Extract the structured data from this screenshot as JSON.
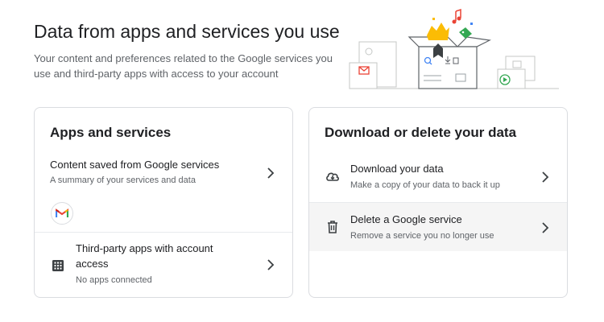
{
  "header": {
    "title": "Data from apps and services you use",
    "subtitle": "Your content and preferences related to the Google services you use and third-party apps with access to your account"
  },
  "apps_card": {
    "title": "Apps and services",
    "items": [
      {
        "title": "Content saved from Google services",
        "description": "A summary of your services and data",
        "icon": "gmail-icon"
      },
      {
        "title": "Third-party apps with account access",
        "description": "No apps connected",
        "icon": "apps-grid-icon"
      }
    ]
  },
  "data_card": {
    "title": "Download or delete your data",
    "items": [
      {
        "title": "Download your data",
        "description": "Make a copy of your data to back it up",
        "icon": "cloud-download-icon"
      },
      {
        "title": "Delete a Google service",
        "description": "Remove a service you no longer use",
        "icon": "trash-icon"
      }
    ]
  },
  "colors": {
    "accent_blue": "#4285f4",
    "accent_red": "#ea4335",
    "accent_yellow": "#fbbc04",
    "accent_green": "#34a853",
    "text_primary": "#202124",
    "text_secondary": "#5f6368",
    "border": "#dadce0"
  }
}
